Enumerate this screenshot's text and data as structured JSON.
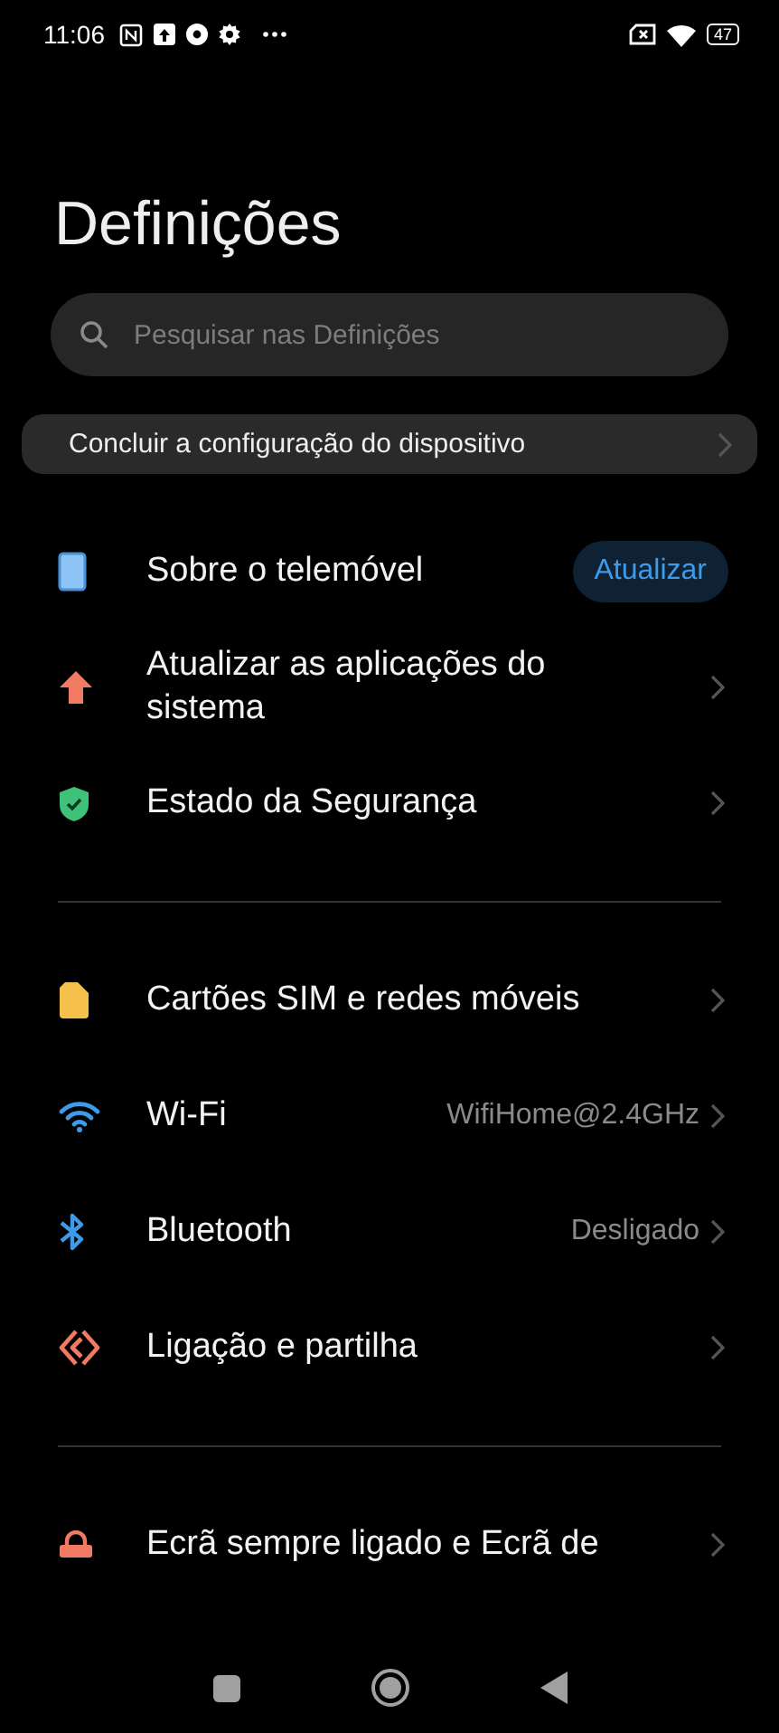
{
  "status_bar": {
    "time": "11:06",
    "battery": "47"
  },
  "title": "Definições",
  "search": {
    "placeholder": "Pesquisar nas Definições"
  },
  "setup_card": {
    "label": "Concluir a configuração do dispositivo"
  },
  "sections": [
    {
      "items": [
        {
          "kind": "phone",
          "label": "Sobre o telemóvel",
          "button": "Atualizar",
          "chevron": false
        },
        {
          "kind": "arrow",
          "label": "Atualizar as aplicações do sistema",
          "chevron": true
        },
        {
          "kind": "shield",
          "label": "Estado da Segurança",
          "chevron": true
        }
      ]
    },
    {
      "items": [
        {
          "kind": "sim",
          "label": "Cartões SIM e redes móveis",
          "chevron": true
        },
        {
          "kind": "wifi",
          "label": "Wi-Fi",
          "value": "WifiHome@2.4GHz",
          "chevron": true
        },
        {
          "kind": "bluetooth",
          "label": "Bluetooth",
          "value": "Desligado",
          "chevron": true
        },
        {
          "kind": "share",
          "label": "Ligação e partilha",
          "chevron": true
        }
      ]
    },
    {
      "items": [
        {
          "kind": "lock",
          "label": "Ecrã sempre ligado e Ecrã de",
          "chevron": true
        }
      ]
    }
  ]
}
